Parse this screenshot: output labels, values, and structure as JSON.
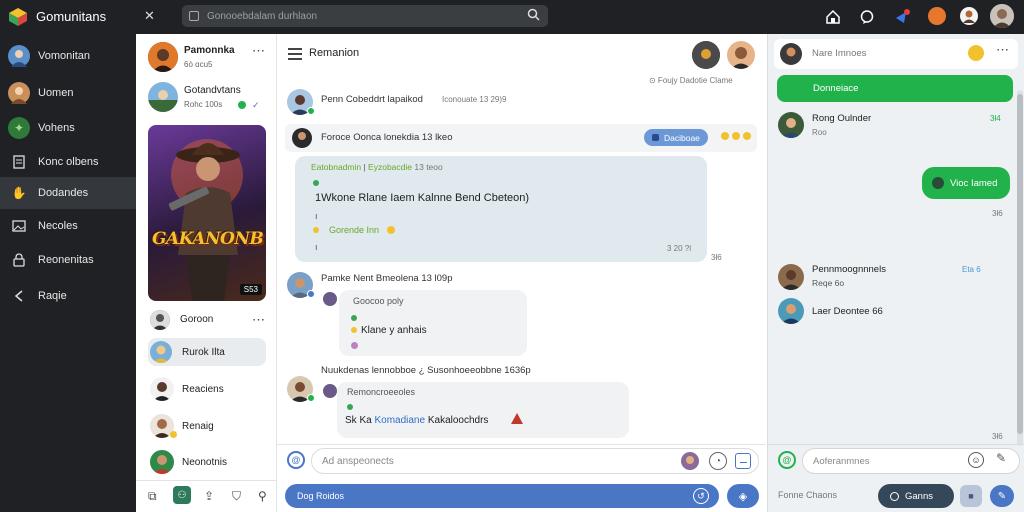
{
  "app": {
    "title": "Gomunitans",
    "search_placeholder": "Gonooebdalam durhlaon"
  },
  "colors": {
    "dark": "#1f2124",
    "accent_green": "#22b24c",
    "accent_blue": "#4a76c6",
    "bubble": "#dfe9ee"
  },
  "sidebar": {
    "items": [
      {
        "label": "Vomonitan",
        "icon": "avatar"
      },
      {
        "label": "Uomen",
        "icon": "avatar"
      },
      {
        "label": "Vohens",
        "icon": "leaf-icon"
      },
      {
        "label": "Konc olbens",
        "icon": "doc-icon"
      },
      {
        "label": "Dodandes",
        "icon": "handshake-icon"
      },
      {
        "label": "Necoles",
        "icon": "image-icon"
      },
      {
        "label": "Reonenitas",
        "icon": "lock-icon"
      },
      {
        "label": "Raqie",
        "icon": "share-icon"
      }
    ]
  },
  "conversations": {
    "header_name": "Pamonnka",
    "header_sub": "6ò ɑcu5",
    "second_name": "Gotandvtans",
    "second_sub": "Rohc 100s",
    "game_art_text": "GAKANONB",
    "game_badge": "S53",
    "section_name": "Goroon",
    "contacts": [
      "Rurok Ilta",
      "Reaciens",
      "Renaig",
      "Neonotnis"
    ]
  },
  "chat": {
    "title": "Remanion",
    "status_line": "⊙ Foujy Dadotie Clame",
    "messages": [
      {
        "name": "Penn Cobeddrt lapaikod",
        "sub": "Iconouate 13 29)9"
      },
      {
        "name": "Foroce Oonca lonekdia 13 lkeo",
        "tag": "Daciboae"
      },
      {
        "name": "Pamke Nent Bmeolena 13 l09p"
      },
      {
        "name": "Nuukdenas lennobboe ¿ Susonhoeeobbne 1636p"
      }
    ],
    "bubble1": {
      "header_a": "Eatobnadmin",
      "header_b": "Eyzobacdie",
      "header_c": "13 teoo",
      "line1": "1Wkone Rlane Iaem Kalnne Bend Cbeteon)",
      "mention": "Gorende Inn",
      "time": "3 20 ?l",
      "time_out": "3ł6"
    },
    "bubble2": {
      "line1": "Goocoo poly",
      "line2": "Klane y anhais"
    },
    "bubble3": {
      "line1": "Remoncroeeoles",
      "prefix": "Sk Ka",
      "link": "Komadiane",
      "suffix": "Kakaloochdrs"
    },
    "input_placeholder": "Ad anspeonects",
    "footer_pill": "Dog Roidos"
  },
  "right": {
    "header": "Nare Imnoes",
    "green_button": "Donneiace",
    "contact1_name": "Rong Oulnder",
    "contact1_sub": "Roo",
    "contact1_time": "3ł4",
    "sent_bubble": "Vioc Iamed",
    "sent_time": "3ł6",
    "contact2_name": "Pennmoognnnels",
    "contact2_time": "Eta 6",
    "contact2_sub": "Reqe 6o",
    "contact3_name": "Laer Deontee 66",
    "bottom_time": "3ł6",
    "input_placeholder": "Aoferanmnes",
    "footer_left": "Fonne Chaons",
    "footer_button": "Ganns"
  }
}
